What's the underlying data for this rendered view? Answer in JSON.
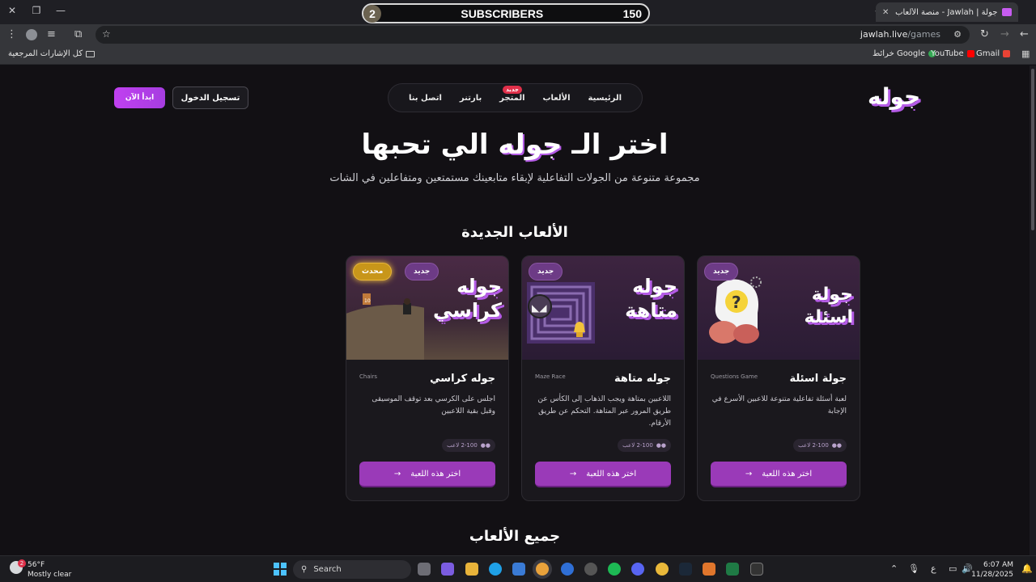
{
  "browser": {
    "tab_title": "جولة | Jawlah - منصة الألعاب الت...",
    "url_host": "jawlah.live",
    "url_path": "/games",
    "bookmarks": {
      "all": "كل الإشارات المرجعية",
      "maps": "خرائط Google",
      "youtube": "YouTube",
      "gmail": "Gmail"
    }
  },
  "overlay": {
    "number": "2",
    "label": "SUBSCRIBERS",
    "count": "150"
  },
  "site": {
    "logo": "جوله",
    "nav": [
      "الرئيسية",
      "الألعاب",
      "المتجر",
      "بارتنر",
      "اتصل بنا"
    ],
    "nav_badge": "جديد",
    "login": "تسجيل الدخول",
    "start": "ابدأ الآن",
    "hero_prefix": "اختر الـ",
    "hero_accent": "جوله",
    "hero_suffix": "الي تحبها",
    "hero_sub": "مجموعة متنوعة من الجولات التفاعلية لإبقاء متابعينك مستمتعين ومتفاعلين في الشات",
    "new_games_title": "الألعاب الجديدة",
    "all_games_title": "جميع الألعاب"
  },
  "cards": [
    {
      "art": "جولة\nاسئلة",
      "badge_new": "جديد",
      "name": "جولة اسئلة",
      "en": "Questions Game",
      "desc": "لعبة أسئلة تفاعلية متنوعة للاعبين الأسرع في الإجابة",
      "players": "2-100 لاعب",
      "button": "اختر هذه اللعبة",
      "arrow": "→"
    },
    {
      "art": "جوله\nمتاهة",
      "badge_new": "جديد",
      "name": "جوله متاهة",
      "en": "Maze Race",
      "desc": "اللاعبين بمتاهة ويجب الذهاب إلى الكأس عن طريق المرور عبر المتاهة. التحكم عن طريق الأرقام.",
      "players": "2-100 لاعب",
      "button": "اختر هذه اللعبة",
      "arrow": "→"
    },
    {
      "art": "جوله\nكراسي",
      "badge_new": "جديد",
      "badge_updated": "محدث",
      "name": "جوله كراسي",
      "en": "Chairs",
      "desc": "اجلس على الكرسي بعد توقف الموسيقى وقبل بقية اللاعبين",
      "players": "2-100 لاعب",
      "button": "اختر هذه اللعبة",
      "arrow": "→"
    }
  ],
  "taskbar": {
    "temp": "56°F",
    "weather": "Mostly clear",
    "search": "Search",
    "lang": "ع",
    "time": "6:07 AM",
    "date": "11/28/2025"
  },
  "colors": {
    "accent": "#b45be6",
    "button": "#9a3ab8",
    "updated": "#c8961a"
  }
}
